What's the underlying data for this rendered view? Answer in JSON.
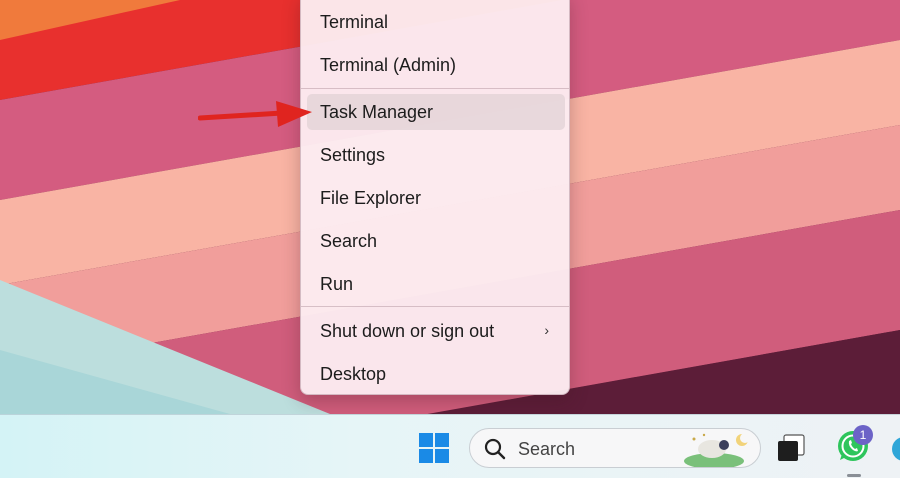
{
  "context_menu": {
    "items": [
      {
        "label": "Terminal"
      },
      {
        "label": "Terminal (Admin)"
      },
      {
        "label": "Task Manager"
      },
      {
        "label": "Settings"
      },
      {
        "label": "File Explorer"
      },
      {
        "label": "Search"
      },
      {
        "label": "Run"
      },
      {
        "label": "Shut down or sign out"
      },
      {
        "label": "Desktop"
      }
    ],
    "highlighted_item": "Task Manager",
    "submenu_chevron": "›"
  },
  "annotation": {
    "icon": "red-arrow-icon",
    "color": "#e0241f"
  },
  "taskbar": {
    "start_icon": "windows-logo-icon",
    "search": {
      "label": "Search",
      "icon": "search-icon"
    },
    "task_view_icon": "task-view-icon",
    "whatsapp": {
      "icon": "whatsapp-icon",
      "badge": "1"
    }
  },
  "colors": {
    "accent": "#0078d4",
    "menu_bg": "#fcecf0",
    "arrow": "#e0241f",
    "badge": "#6c63c7"
  }
}
